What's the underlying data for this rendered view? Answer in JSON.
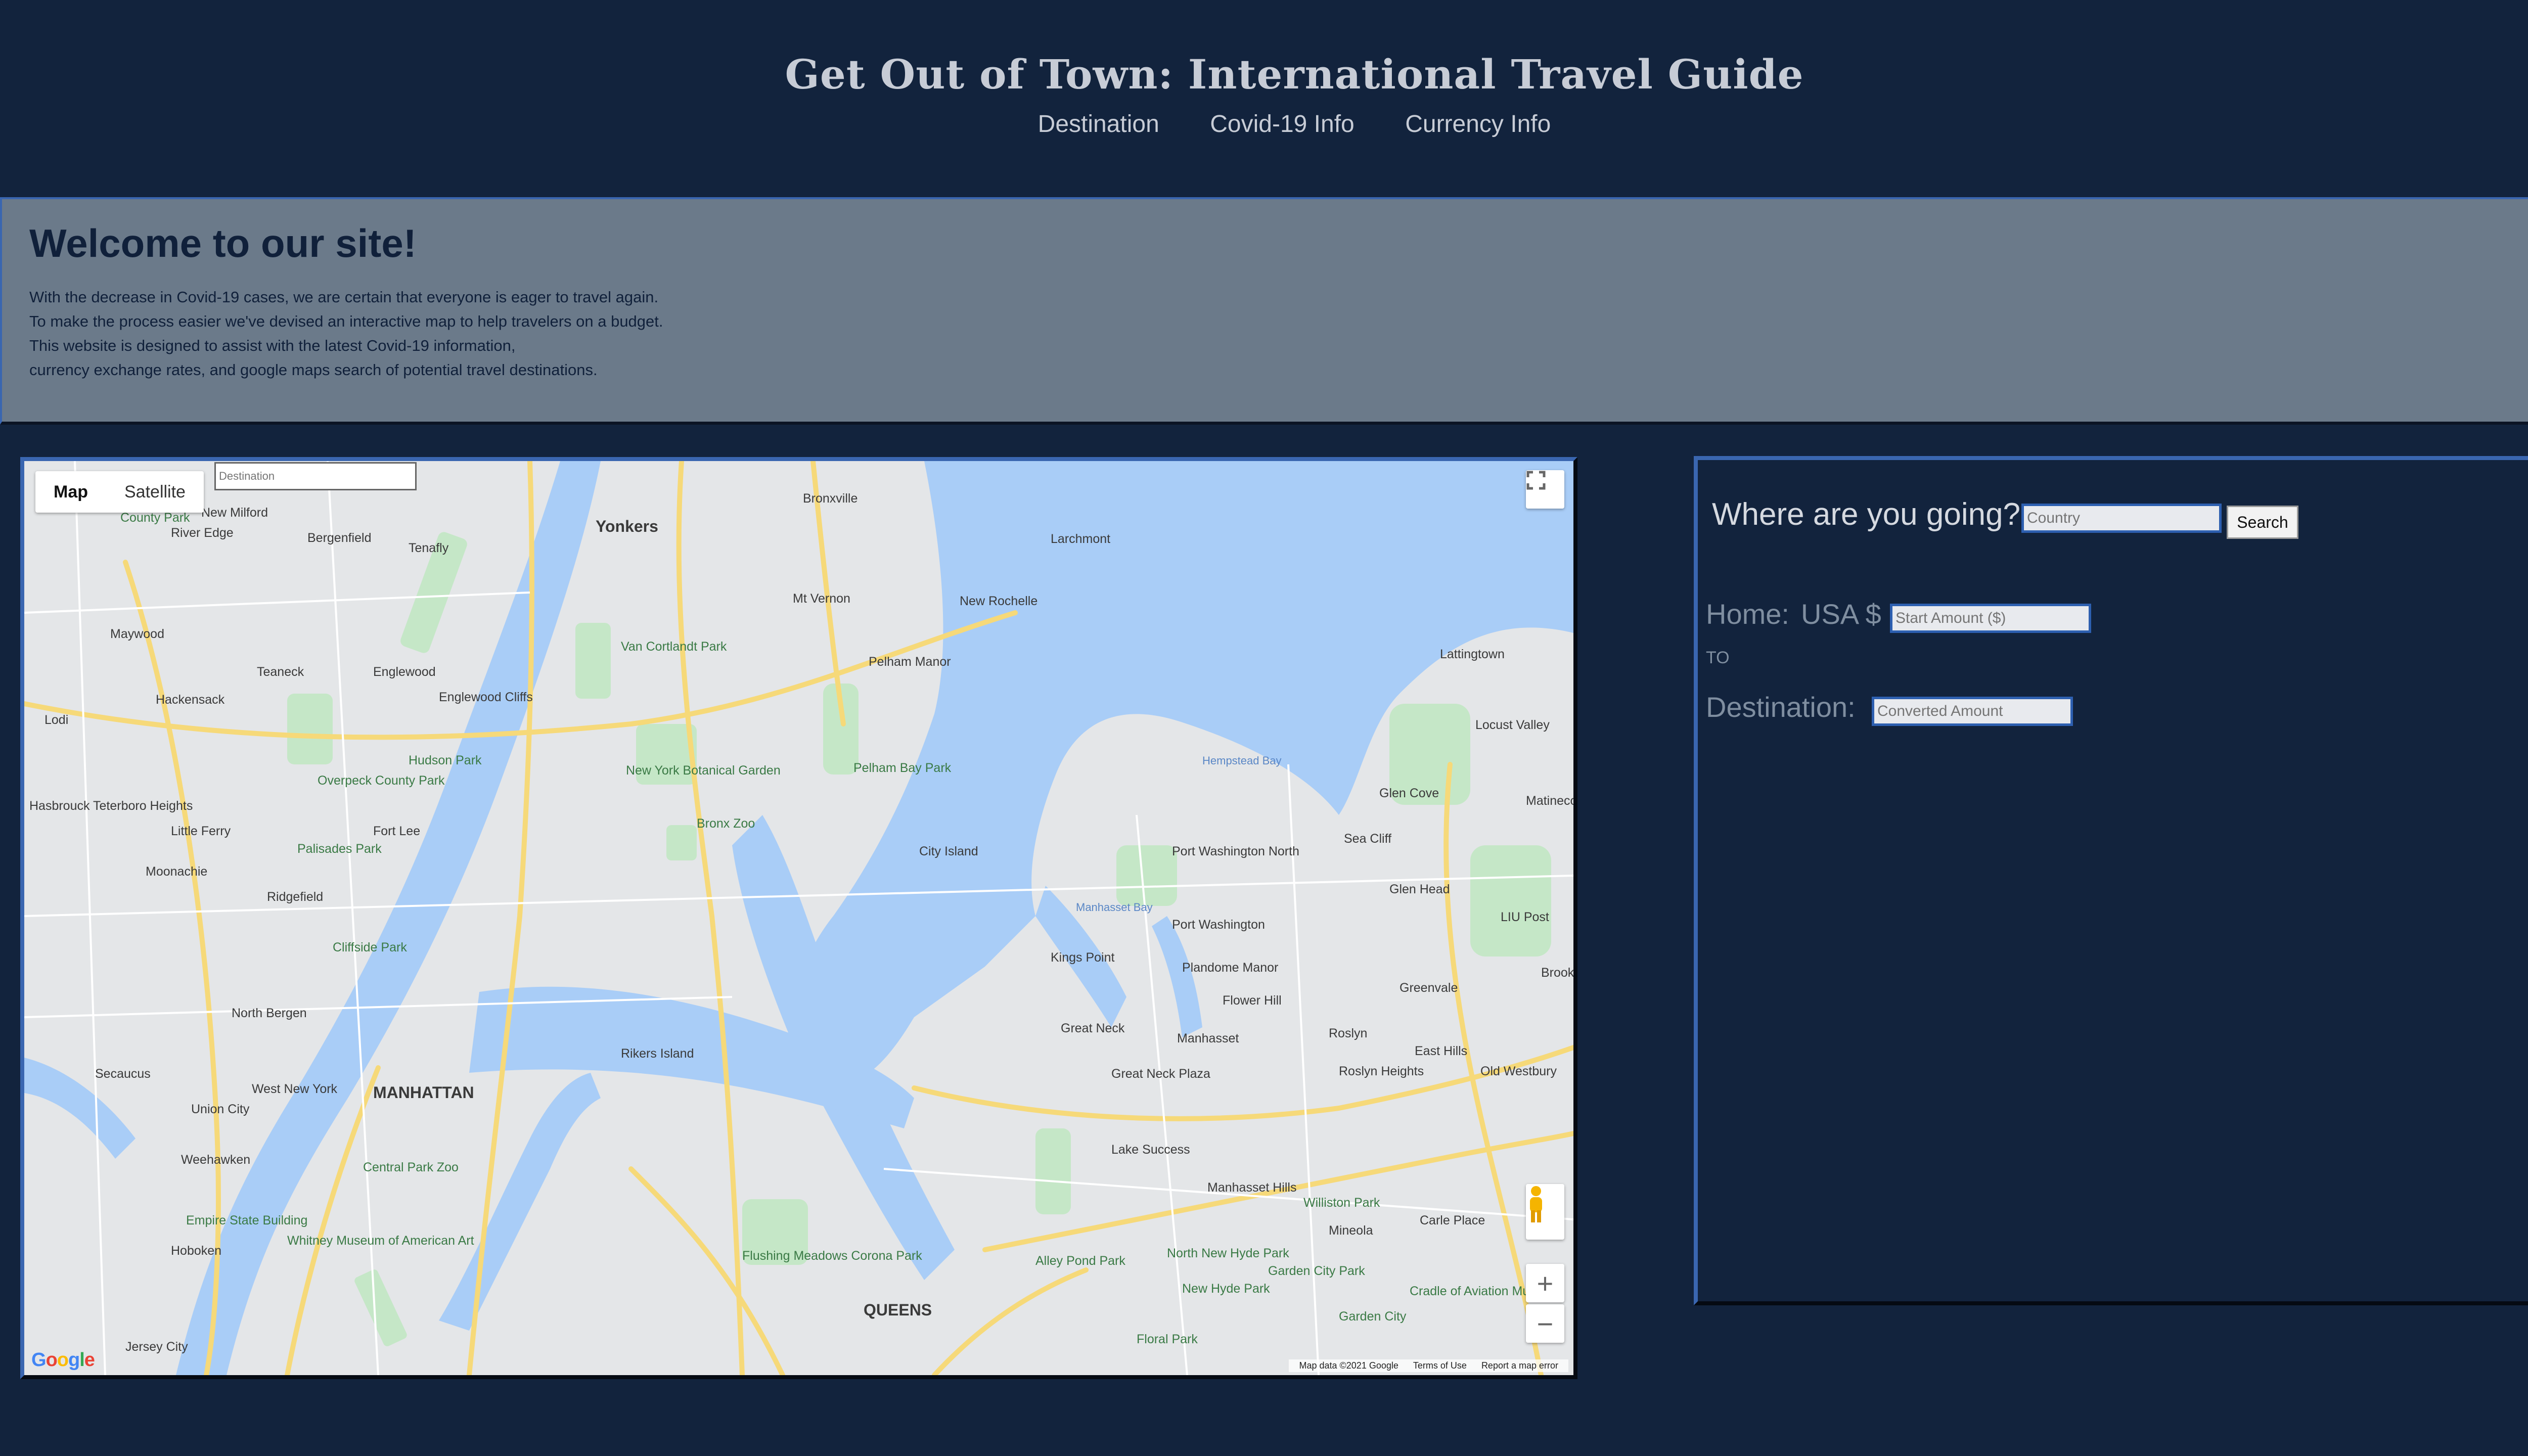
{
  "header": {
    "title": "Get Out of Town: International Travel Guide",
    "nav": [
      "Destination",
      "Covid-19 Info",
      "Currency Info"
    ]
  },
  "welcome": {
    "heading": "Welcome to our site!",
    "lines": [
      "With the decrease in Covid-19 cases, we are certain that everyone is eager to travel again.",
      "To make the process easier we've devised an interactive map to help travelers on a budget.",
      "This website is designed to assist with the latest Covid-19 information,",
      "currency exchange rates, and google maps search of potential travel destinations."
    ]
  },
  "map": {
    "type_controls": [
      "Map",
      "Satellite"
    ],
    "active_type": "Map",
    "destination_placeholder": "Destination",
    "fullscreen_icon": "fullscreen-icon",
    "pegman_icon": "pegman-icon",
    "zoom_in": "+",
    "zoom_out": "−",
    "logo": "Google",
    "footer": [
      "Map data ©2021 Google",
      "Terms of Use",
      "Report a map error"
    ],
    "places": [
      "Yonkers",
      "Bronxville",
      "Larchmont",
      "Mt Vernon",
      "New Rochelle",
      "New Milford",
      "County Park",
      "River Edge",
      "Bergenfield",
      "Tenafly",
      "Maywood",
      "Teaneck",
      "Englewood",
      "Englewood Cliffs",
      "Hackensack",
      "Lodi",
      "Van Cortlandt Park",
      "Pelham Manor",
      "New York Botanical Garden",
      "Bronx Zoo",
      "Pelham Bay Park",
      "Hudson Park",
      "Overpeck County Park",
      "Fort Lee",
      "Palisades Park",
      "Little Ferry",
      "Moonachie",
      "Ridgefield",
      "Cliffside Park",
      "Hasbrouck Teterboro Heights",
      "City Island",
      "Kings Point",
      "Port Washington North",
      "Port Washington",
      "Plandome Manor",
      "Flower Hill",
      "Great Neck",
      "Great Neck Plaza",
      "Manhasset",
      "Roslyn",
      "Roslyn Heights",
      "East Hills",
      "Old Westbury",
      "Glen Cove",
      "Sea Cliff",
      "Glen Head",
      "Lattingtown",
      "Locust Valley",
      "Matinecock",
      "LIU Post",
      "Greenvale",
      "Brookville",
      "North Bergen",
      "Secaucus",
      "West New York",
      "Union City",
      "Weehawken",
      "MANHATTAN",
      "Central Park Zoo",
      "Rikers Island",
      "Empire State Building",
      "Whitney Museum of American Art",
      "Hoboken",
      "Flushing Meadows Corona Park",
      "QUEENS",
      "Lake Success",
      "Manhasset Hills",
      "Williston Park",
      "Carle Place",
      "Mineola",
      "North New Hyde Park",
      "New Hyde Park",
      "Garden City Park",
      "Alley Pond Park",
      "Floral Park",
      "Cradle of Aviation Museum",
      "Garden City",
      "Jersey City",
      "Hempstead Bay",
      "Manhasset Bay"
    ]
  },
  "converter": {
    "prompt": "Where are you going?",
    "country_placeholder": "Country",
    "search_label": "Search",
    "home_label": "Home:",
    "home_currency": "USA $",
    "start_placeholder": "Start Amount ($)",
    "to_label": "TO",
    "destination_label": "Destination:",
    "converted_placeholder": "Converted Amount"
  },
  "colors": {
    "background": "#12233d",
    "banner": "#6b7a8a",
    "accent": "#3a66b0",
    "water": "#a9cdf7",
    "park": "#c5e7c7",
    "highway": "#f6d979"
  }
}
